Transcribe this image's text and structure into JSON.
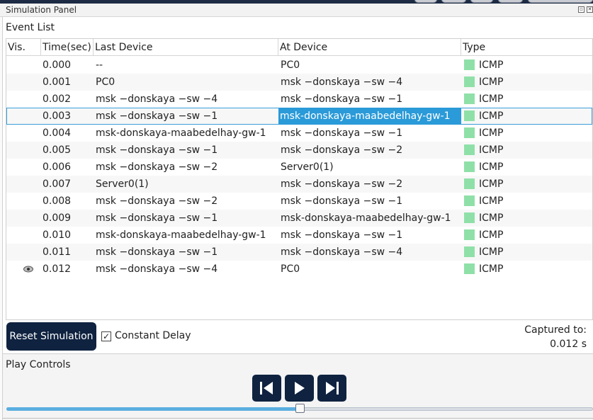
{
  "window": {
    "title": "Simulation Panel"
  },
  "event_list": {
    "label": "Event List",
    "columns": [
      "Vis.",
      "Time(sec)",
      "Last Device",
      "At Device",
      "Type"
    ],
    "rows": [
      {
        "vis": "",
        "time": "0.000",
        "last": "--",
        "at": "PC0",
        "type": "ICMP"
      },
      {
        "vis": "",
        "time": "0.001",
        "last": "PC0",
        "at": "msk −donskaya −sw −4",
        "type": "ICMP"
      },
      {
        "vis": "",
        "time": "0.002",
        "last": "msk −donskaya −sw −4",
        "at": "msk −donskaya −sw −1",
        "type": "ICMP"
      },
      {
        "vis": "",
        "time": "0.003",
        "last": "msk −donskaya −sw −1",
        "at": "msk-donskaya-maabedelhay-gw-1",
        "type": "ICMP",
        "selected": true
      },
      {
        "vis": "",
        "time": "0.004",
        "last": "msk-donskaya-maabedelhay-gw-1",
        "at": "msk −donskaya −sw −1",
        "type": "ICMP"
      },
      {
        "vis": "",
        "time": "0.005",
        "last": "msk −donskaya −sw −1",
        "at": "msk −donskaya −sw −2",
        "type": "ICMP"
      },
      {
        "vis": "",
        "time": "0.006",
        "last": "msk −donskaya −sw −2",
        "at": "Server0(1)",
        "type": "ICMP"
      },
      {
        "vis": "",
        "time": "0.007",
        "last": "Server0(1)",
        "at": "msk −donskaya −sw −2",
        "type": "ICMP"
      },
      {
        "vis": "",
        "time": "0.008",
        "last": "msk −donskaya −sw −2",
        "at": "msk −donskaya −sw −1",
        "type": "ICMP"
      },
      {
        "vis": "",
        "time": "0.009",
        "last": "msk −donskaya −sw −1",
        "at": "msk-donskaya-maabedelhay-gw-1",
        "type": "ICMP"
      },
      {
        "vis": "",
        "time": "0.010",
        "last": "msk-donskaya-maabedelhay-gw-1",
        "at": "msk −donskaya −sw −1",
        "type": "ICMP"
      },
      {
        "vis": "",
        "time": "0.011",
        "last": "msk −donskaya −sw −1",
        "at": "msk −donskaya −sw −4",
        "type": "ICMP"
      },
      {
        "vis": "eye-icon",
        "time": "0.012",
        "last": "msk −donskaya −sw −4",
        "at": "PC0",
        "type": "ICMP"
      }
    ],
    "type_color": "#8fe0a8",
    "selection_color": "#2a9ad8"
  },
  "controls": {
    "reset_label": "Reset Simulation",
    "constant_delay_label": "Constant Delay",
    "constant_delay_checked": true,
    "captured_label": "Captured to:",
    "captured_value": "0.012 s"
  },
  "play_controls": {
    "label": "Play Controls",
    "buttons": [
      "back-icon",
      "play-icon",
      "forward-icon"
    ],
    "slider_fraction": 0.5
  },
  "colors": {
    "accent": "#0f2240",
    "slider": "#5aaee0"
  }
}
